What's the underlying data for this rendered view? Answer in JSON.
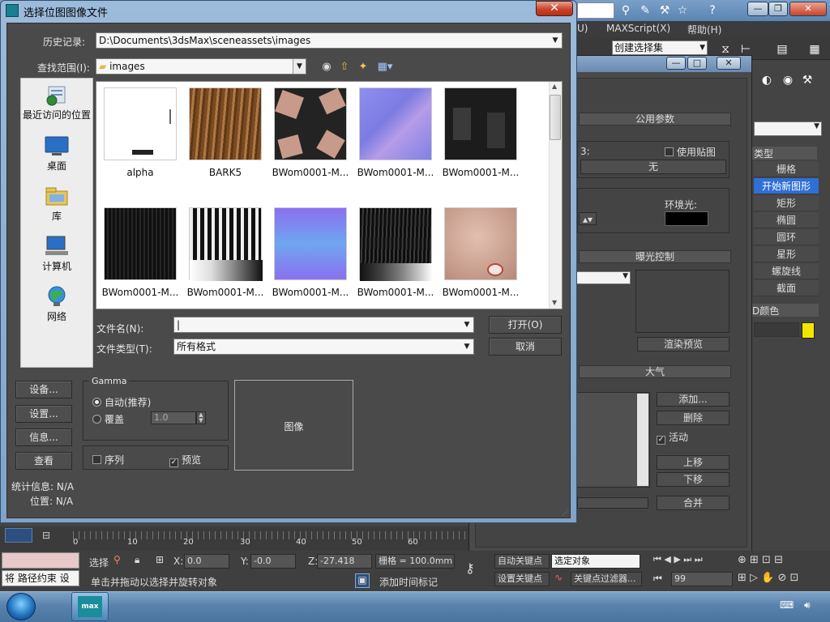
{
  "dialog": {
    "title": "选择位图图像文件",
    "close_label": "✕",
    "history_label": "历史记录:",
    "history_value": "D:\\Documents\\3dsMax\\sceneassets\\images",
    "lookin_label": "查找范围(I):",
    "lookin_value": "images",
    "places": [
      {
        "label": "最近访问的位置",
        "icon": "recent-places-icon"
      },
      {
        "label": "桌面",
        "icon": "desktop-icon"
      },
      {
        "label": "库",
        "icon": "libraries-icon"
      },
      {
        "label": "计算机",
        "icon": "computer-icon"
      },
      {
        "label": "网络",
        "icon": "network-icon"
      }
    ],
    "files": [
      {
        "name": "alpha",
        "swatch": "#ffffff"
      },
      {
        "name": "BARK5",
        "swatch": "#8b5a2b"
      },
      {
        "name": "BWom0001-M...",
        "swatch": "#2a2a2a"
      },
      {
        "name": "BWom0001-M...",
        "swatch": "#8a8ae8"
      },
      {
        "name": "BWom0001-M...",
        "swatch": "#1e1e1e"
      },
      {
        "name": "BWom0001-M...",
        "swatch": "#111111"
      },
      {
        "name": "BWom0001-M...",
        "swatch": "#d8d8d8"
      },
      {
        "name": "BWom0001-M...",
        "swatch": "#7f7fe6"
      },
      {
        "name": "BWom0001-M...",
        "swatch": "#141414"
      },
      {
        "name": "BWom0001-M...",
        "swatch": "#caa89a"
      }
    ],
    "filename_label": "文件名(N):",
    "filename_value": "|",
    "filetype_label": "文件类型(T):",
    "filetype_value": "所有格式",
    "open_label": "打开(O)",
    "cancel_label": "取消",
    "setup_label": "设备...",
    "settings_label": "设置...",
    "info_label": "信息...",
    "view_label": "查看",
    "gamma_title": "Gamma",
    "gamma_auto": "自动(推荐)",
    "gamma_override": "覆盖",
    "gamma_override_value": "1.0",
    "sequence_label": "序列",
    "preview_label": "预览",
    "preview_box_label": "图像",
    "stats_label": "统计信息: N/A",
    "location_label": "位置: N/A"
  },
  "app": {
    "menu": [
      "U)",
      "MAXScript(X)",
      "帮助(H)"
    ],
    "selection_set": "创建选择集",
    "cmd_type_header": "类型",
    "cmd_items": [
      "栅格",
      "开始新图形",
      "矩形",
      "椭圆",
      "圆环",
      "星形",
      "螺旋线",
      "截面"
    ],
    "cmd_color_header": "D颜色",
    "env": {
      "common_params": "公用参数",
      "use_map": "使用贴图",
      "none_btn": "无",
      "bg_fragment": "3:",
      "ambient": "环境光:",
      "exposure": "曝光控制",
      "render_preview": "渲染预览",
      "atmosphere": "大气",
      "add": "添加...",
      "delete": "删除",
      "active": "活动",
      "move_up": "上移",
      "move_down": "下移",
      "merge": "合并"
    },
    "timeline_ticks": [
      "0",
      "10",
      "20",
      "30",
      "40",
      "50",
      "60"
    ],
    "status": {
      "select_prefix": "选择",
      "x_label": "X:",
      "x_value": "0.0",
      "y_label": "Y:",
      "y_value": "-0.0",
      "z_label": "Z:",
      "z_value": "-27.418",
      "grid": "栅格 = 100.0mm",
      "auto_key": "自动关键点",
      "selected_obj": "选定对象",
      "set_key": "设置关键点",
      "key_filter": "关键点过滤器...",
      "frame_value": "99",
      "prompt": "单击并拖动以选择并旋转对象",
      "add_time_tag": "添加时间标记",
      "maxscript_line": "将 路径约束 设"
    }
  }
}
